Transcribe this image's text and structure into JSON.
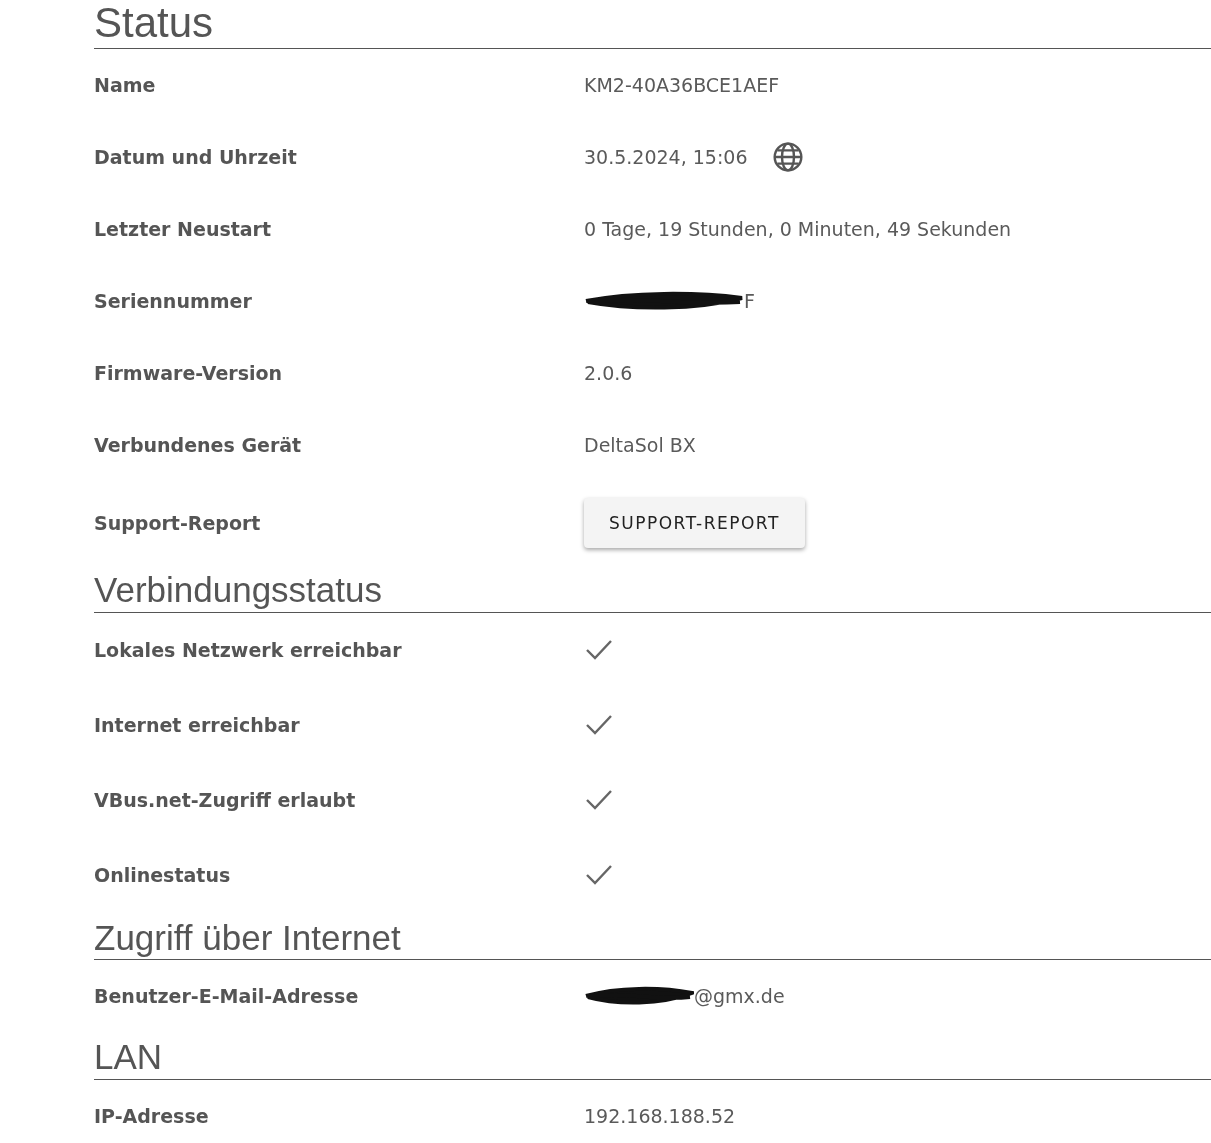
{
  "sections": [
    {
      "title": "Status",
      "rows": [
        {
          "label": "Name",
          "kind": "text",
          "value": "KM2-40A36BCE1AEF"
        },
        {
          "label": "Datum und Uhrzeit",
          "kind": "time",
          "value": "30.5.2024, 15:06"
        },
        {
          "label": "Letzter Neustart",
          "kind": "text",
          "value": "0 Tage, 19 Stunden, 0 Minuten, 49 Sekunden"
        },
        {
          "label": "Seriennummer",
          "kind": "redacted",
          "value": "F"
        },
        {
          "label": "Firmware-Version",
          "kind": "text",
          "value": "2.0.6"
        },
        {
          "label": "Verbundenes Gerät",
          "kind": "text",
          "value": "DeltaSol BX"
        },
        {
          "label": "Support-Report",
          "kind": "button",
          "value": "SUPPORT-REPORT"
        }
      ]
    },
    {
      "title": "Verbindungsstatus",
      "rows": [
        {
          "label": "Lokales Netzwerk erreichbar",
          "kind": "check",
          "checked": true
        },
        {
          "label": "Internet erreichbar",
          "kind": "check",
          "checked": true
        },
        {
          "label": "VBus.net-Zugriff erlaubt",
          "kind": "check",
          "checked": true
        },
        {
          "label": "Onlinestatus",
          "kind": "check",
          "checked": true
        }
      ]
    },
    {
      "title": "Zugriff über Internet",
      "rows": [
        {
          "label": "Benutzer-E-Mail-Adresse",
          "kind": "redacted",
          "value": "@gmx.de"
        }
      ]
    },
    {
      "title": "LAN",
      "rows": [
        {
          "label": "IP-Adresse",
          "kind": "text",
          "value": "192.168.188.52"
        }
      ]
    }
  ]
}
